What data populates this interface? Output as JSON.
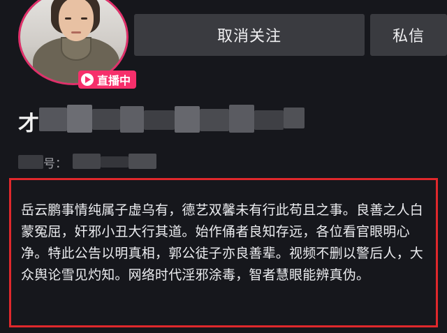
{
  "profile": {
    "live_badge": "直播中",
    "name_visible_char": "才",
    "id_label": "号：",
    "avatar_icon": "avatar-photo",
    "live_icon": "play-icon"
  },
  "actions": {
    "unfollow_label": "取消关注",
    "message_label": "私信"
  },
  "statement": {
    "text": "岳云鹏事情纯属子虚乌有，德艺双馨未有行此苟且之事。良善之人白蒙冤屈，奸邪小丑大行其道。始作俑者良知存远，各位看官眼明心净。特此公告以明真相，郭公徒子亦良善辈。视频不删以警后人，大众舆论雪见灼知。网络时代淫邪涂毒，智者慧眼能辨真伪。"
  },
  "colors": {
    "background": "#16171c",
    "button": "#3a3b40",
    "live_pink": "#f62f6b",
    "highlight_red": "#e0282c"
  }
}
